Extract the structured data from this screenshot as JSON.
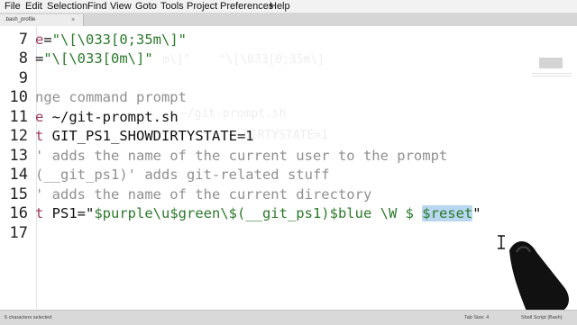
{
  "menu": [
    "File",
    "Edit",
    "Selection",
    "Find",
    "View",
    "Goto",
    "Tools",
    "Project",
    "Preferences",
    "Help"
  ],
  "tab": {
    "name": ".bash_profile",
    "close": "×"
  },
  "lines": [
    {
      "num": "7",
      "text": "e=\"\\[\\033[0;35m\\]\""
    },
    {
      "num": "8",
      "text": "=\"\\[\\033[0m\\]\""
    },
    {
      "num": "9",
      "text": ""
    },
    {
      "num": "10",
      "text": "nge command prompt"
    },
    {
      "num": "11",
      "text": "e ~/git-prompt.sh"
    },
    {
      "num": "12",
      "text": "t GIT_PS1_SHOWDIRTYSTATE=1"
    },
    {
      "num": "13",
      "text": "' adds the name of the current user to the prompt"
    },
    {
      "num": "14",
      "text": "(__git_ps1)' adds git-related stuff"
    },
    {
      "num": "15",
      "text": "' adds the name of the current directory"
    },
    {
      "num": "16",
      "text": "t PS1=\"$purple\\u$green\\$(__git_ps1)$blue \\W $ $reset\""
    },
    {
      "num": "17",
      "text": ""
    }
  ],
  "status": {
    "left": "6 characters selected",
    "tab_size": "Tab Size: 4",
    "syntax": "Shell Script (Bash)"
  }
}
